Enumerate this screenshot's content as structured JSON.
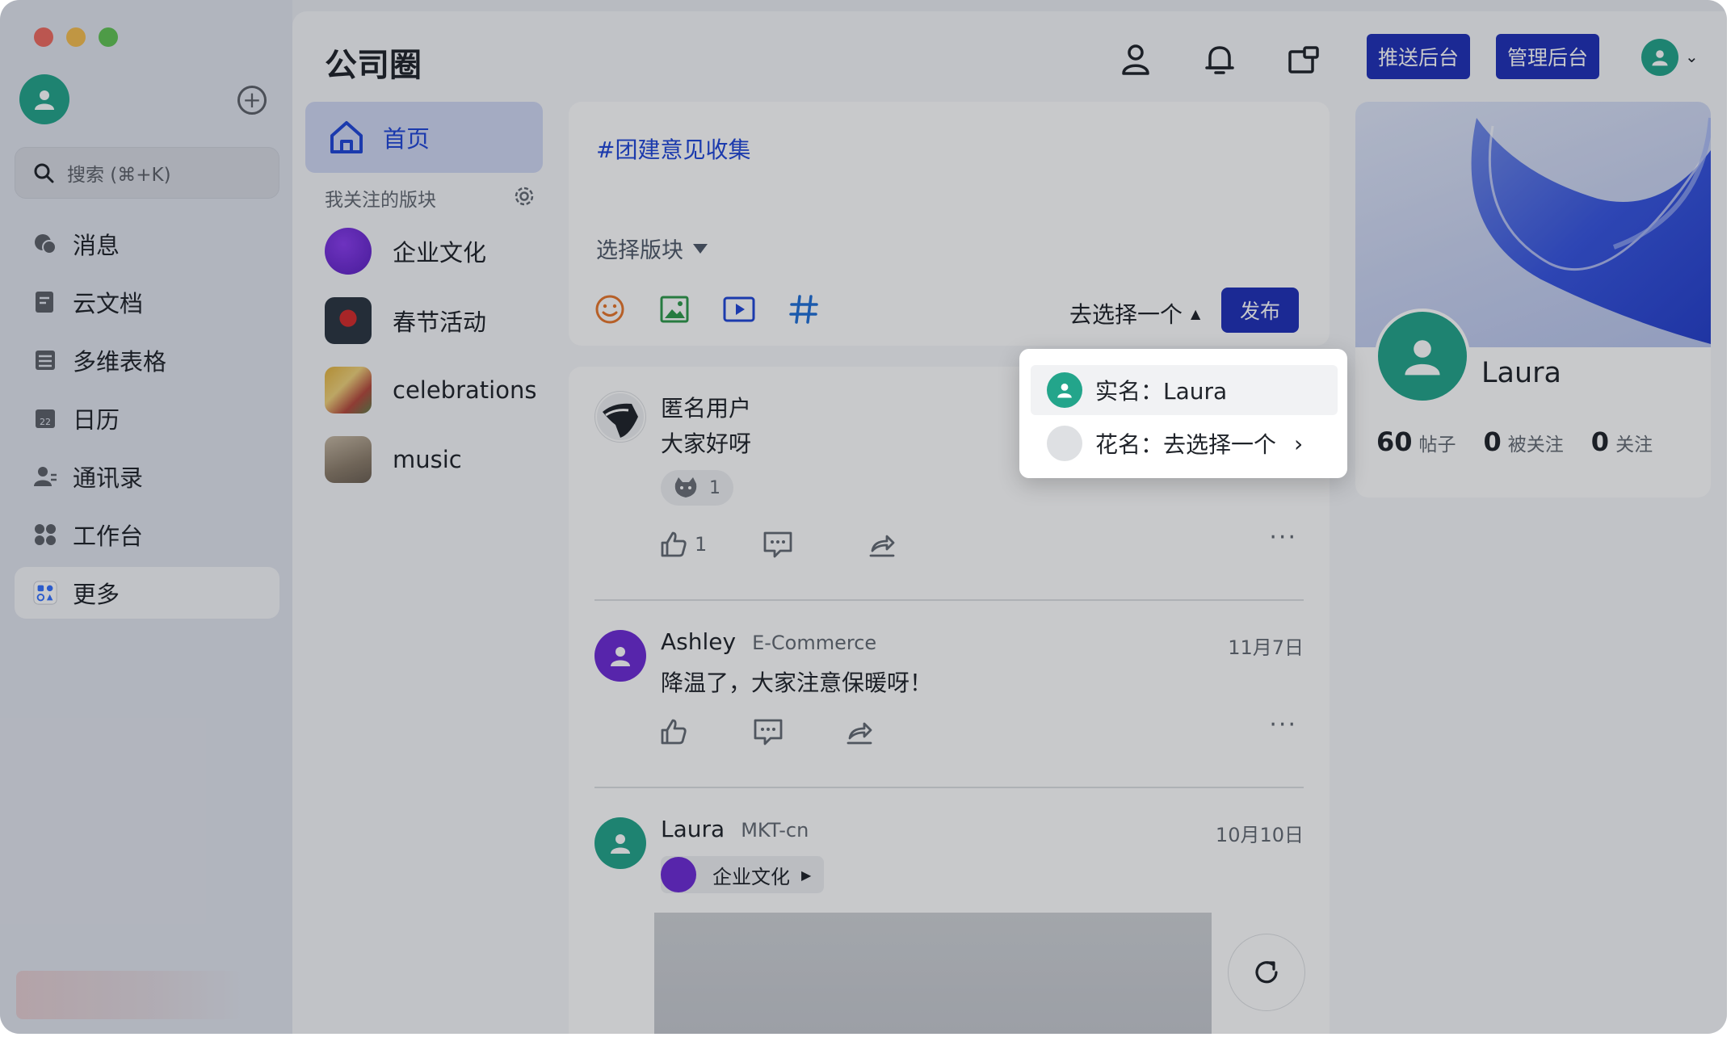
{
  "sidebar": {
    "search_placeholder": "搜索 (⌘+K)",
    "items": [
      {
        "label": "消息",
        "icon": "chat-bubble-icon"
      },
      {
        "label": "云文档",
        "icon": "cloud-doc-icon"
      },
      {
        "label": "多维表格",
        "icon": "table-icon"
      },
      {
        "label": "日历",
        "icon": "calendar-icon",
        "badge": "22"
      },
      {
        "label": "通讯录",
        "icon": "contacts-icon"
      },
      {
        "label": "工作台",
        "icon": "workplace-icon"
      },
      {
        "label": "更多",
        "icon": "more-apps-icon"
      }
    ]
  },
  "header": {
    "title": "公司圈",
    "push_admin": "推送后台",
    "manage_admin": "管理后台"
  },
  "boards": {
    "home_label": "首页",
    "followed_heading": "我关注的版块",
    "items": [
      {
        "label": "企业文化"
      },
      {
        "label": "春节活动"
      },
      {
        "label": "celebrations"
      },
      {
        "label": "music"
      }
    ]
  },
  "composer": {
    "hashtag_text": "#团建意见收集",
    "choose_board": "选择版块",
    "identity_select": "去选择一个",
    "publish": "发布"
  },
  "identity_menu": {
    "real_name": "实名：Laura",
    "nickname": "花名：去选择一个"
  },
  "posts": [
    {
      "author": "匿名用户",
      "text": "大家好呀",
      "reaction_count": "1",
      "like_count": "1"
    },
    {
      "author": "Ashley",
      "dept": "E-Commerce",
      "date": "11月7日",
      "text": "降温了，大家注意保暖呀！"
    },
    {
      "author": "Laura",
      "dept": "MKT-cn",
      "date": "10月10日",
      "board_chip": "企业文化"
    }
  ],
  "profile": {
    "name": "Laura",
    "posts_count": "60",
    "posts_label": "帖子",
    "followers_count": "0",
    "followers_label": "被关注",
    "following_count": "0",
    "following_label": "关注"
  },
  "colors": {
    "accent": "#1f2fb8",
    "link": "#1f45d8",
    "avatar_green": "#23a58b",
    "avatar_purple": "#6d2ad6"
  }
}
